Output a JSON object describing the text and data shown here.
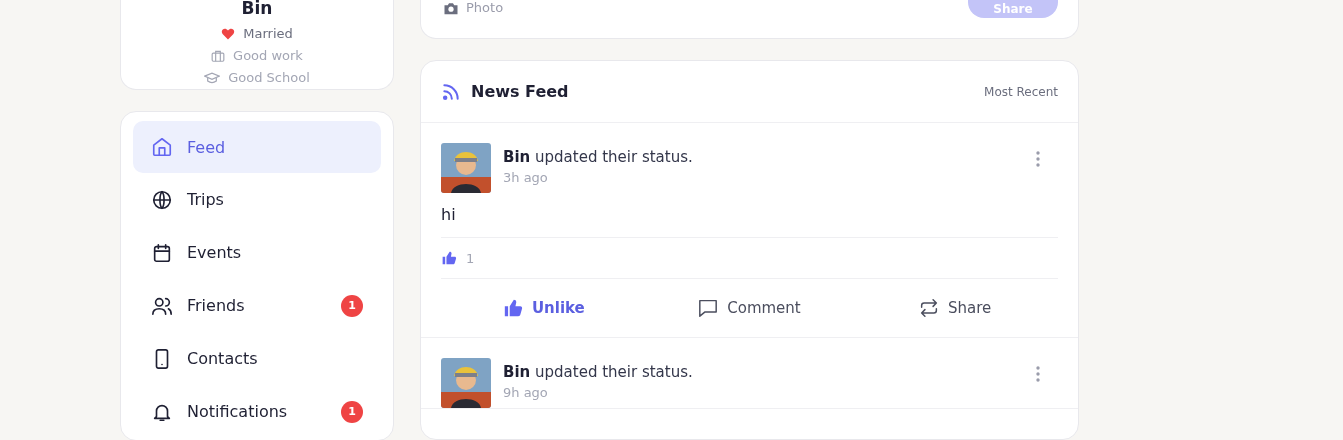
{
  "profile": {
    "name": "Bin",
    "details": [
      {
        "kind": "relationship",
        "text": "Married"
      },
      {
        "kind": "work",
        "text": "Good work"
      },
      {
        "kind": "school",
        "text": "Good School"
      }
    ]
  },
  "nav": [
    {
      "kind": "home",
      "label": "Feed",
      "selected": true
    },
    {
      "kind": "globe",
      "label": "Trips",
      "selected": false
    },
    {
      "kind": "calendar",
      "label": "Events",
      "selected": false
    },
    {
      "kind": "people",
      "label": "Friends",
      "selected": false,
      "badge": "1"
    },
    {
      "kind": "phone",
      "label": "Contacts",
      "selected": false
    },
    {
      "kind": "bell",
      "label": "Notifications",
      "selected": false,
      "badge": "1"
    }
  ],
  "composer": {
    "photo_label": "Photo",
    "share_button": "Share",
    "disabled": true
  },
  "feed": {
    "title": "News Feed",
    "sort": "Most Recent",
    "posts": [
      {
        "headline": "**Bin** updated their status.",
        "time": "3h ago",
        "text": "hi",
        "likes": "1",
        "liked": true,
        "actions": [
          {
            "kind": "like",
            "label": "Unlike"
          },
          {
            "kind": "comment",
            "label": "Comment"
          },
          {
            "kind": "share",
            "label": "Share"
          }
        ]
      },
      {
        "headline": "**Bin** updated their status.",
        "time": "9h ago"
      }
    ]
  }
}
